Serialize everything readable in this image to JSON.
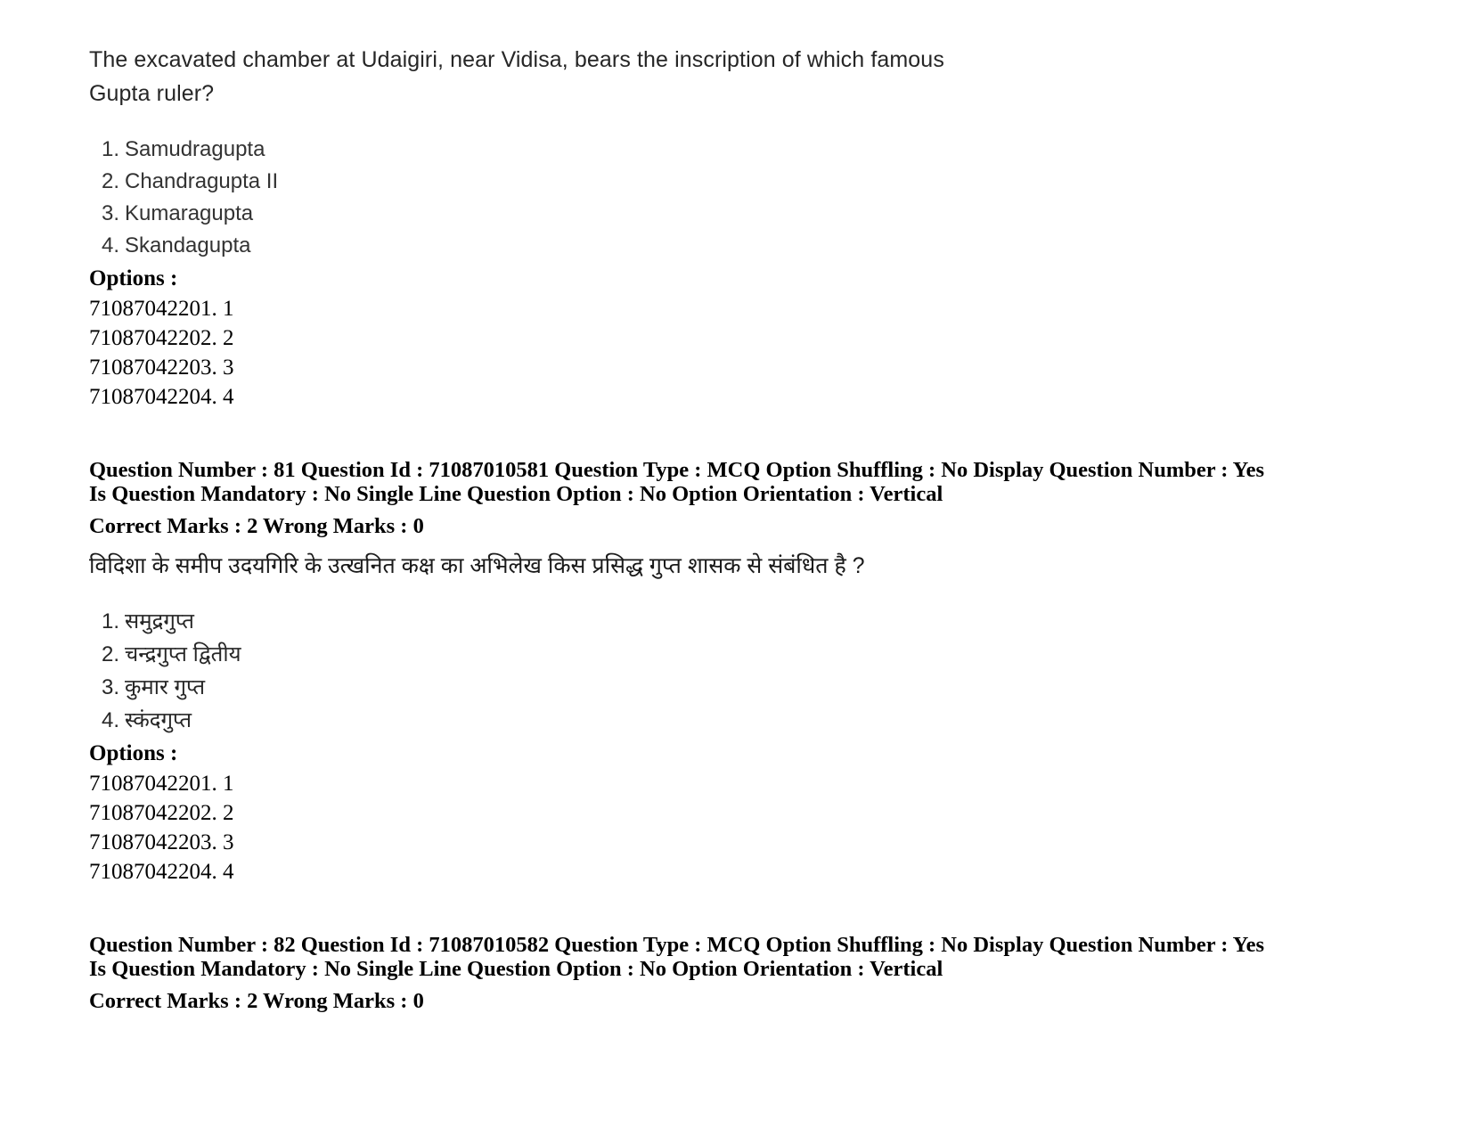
{
  "document": {
    "language_primary": "English",
    "language_secondary": "Hindi"
  },
  "question_en": {
    "text": "The excavated chamber at Udaigiri, near Vidisa, bears the inscription of which famous Gupta ruler?",
    "options": [
      {
        "num": "1.",
        "label": "Samudragupta"
      },
      {
        "num": "2.",
        "label": "Chandragupta II"
      },
      {
        "num": "3.",
        "label": "Kumaragupta"
      },
      {
        "num": "4.",
        "label": "Skandagupta"
      }
    ],
    "options_label": "Options :",
    "option_codes": [
      "71087042201. 1",
      "71087042202. 2",
      "71087042203. 3",
      "71087042204. 4"
    ]
  },
  "meta_81": {
    "line1": "Question Number : 81 Question Id : 71087010581 Question Type : MCQ Option Shuffling : No Display Question Number : Yes Is Question Mandatory : No Single Line Question Option : No Option Orientation : Vertical",
    "marks": "Correct Marks : 2 Wrong Marks : 0",
    "question_number": "81",
    "question_id": "71087010581",
    "question_type": "MCQ",
    "option_shuffling": "No",
    "display_question_number": "Yes",
    "is_question_mandatory": "No",
    "single_line_question_option": "No",
    "option_orientation": "Vertical",
    "correct_marks": "2",
    "wrong_marks": "0"
  },
  "question_hi": {
    "text": "विदिशा के समीप उदयगिरि के उत्खनित कक्ष का अभिलेख किस प्रसिद्ध गुप्त शासक से संबंधित है ?",
    "options": [
      {
        "num": "1.",
        "label": "समुद्रगुप्त"
      },
      {
        "num": "2.",
        "label": "चन्द्रगुप्त द्वितीय"
      },
      {
        "num": "3.",
        "label": "कुमार गुप्त"
      },
      {
        "num": "4.",
        "label": "स्कंदगुप्त"
      }
    ],
    "options_label": "Options :",
    "option_codes": [
      "71087042201. 1",
      "71087042202. 2",
      "71087042203. 3",
      "71087042204. 4"
    ]
  },
  "meta_82": {
    "line1": "Question Number : 82 Question Id : 71087010582 Question Type : MCQ Option Shuffling : No Display Question Number : Yes Is Question Mandatory : No Single Line Question Option : No Option Orientation : Vertical",
    "marks": "Correct Marks : 2 Wrong Marks : 0",
    "question_number": "82",
    "question_id": "71087010582",
    "question_type": "MCQ",
    "option_shuffling": "No",
    "display_question_number": "Yes",
    "is_question_mandatory": "No",
    "single_line_question_option": "No",
    "option_orientation": "Vertical",
    "correct_marks": "2",
    "wrong_marks": "0"
  }
}
